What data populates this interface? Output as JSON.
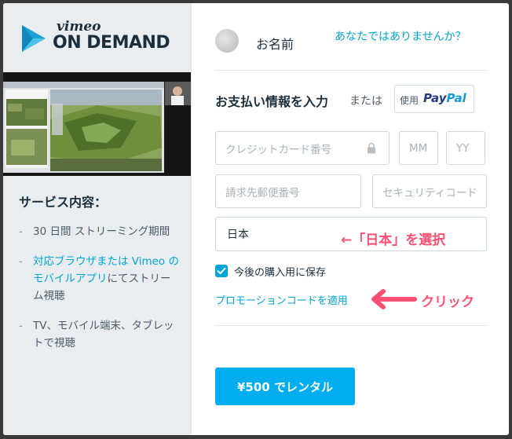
{
  "brand": {
    "vimeo": "vimeo",
    "on_demand": "ON DEMAND",
    "logo_color": "#1a2e3b",
    "logo_blue": "#1aa1d6"
  },
  "service": {
    "title": "サービス内容：",
    "items": [
      {
        "text": "30 日間 ストリーミング期間"
      },
      {
        "link": "対応ブラウザまたは Vimeo のモバイルアプリ",
        "text": "にてストリーム視聴"
      },
      {
        "text": "TV、モバイル端末、タブレットで視聴"
      }
    ]
  },
  "account": {
    "username": "お名前",
    "not_you": "あなたではありませんか？"
  },
  "payment": {
    "title": "お支払い情報を入力",
    "or": "または",
    "paypal_use": "使用",
    "paypal_1": "Pay",
    "paypal_2": "Pal",
    "card_placeholder": "クレジットカード番号",
    "mm_placeholder": "MM",
    "yy_placeholder": "YY",
    "zip_placeholder": "請求先郵便番号",
    "cvc_placeholder": "セキュリティコード",
    "country_value": "日本",
    "save_label": "今後の購入用に保存",
    "save_checked": true,
    "promo_link": "プロモーションコードを適用",
    "rent_button": "¥500 でレンタル"
  },
  "annotations": {
    "select_japan": "←「日本」を選択",
    "click": "クリック",
    "color": "#ff4f73"
  },
  "colors": {
    "accent": "#00a5d8",
    "button": "#00adef",
    "left_panel": "#e9edf0"
  }
}
